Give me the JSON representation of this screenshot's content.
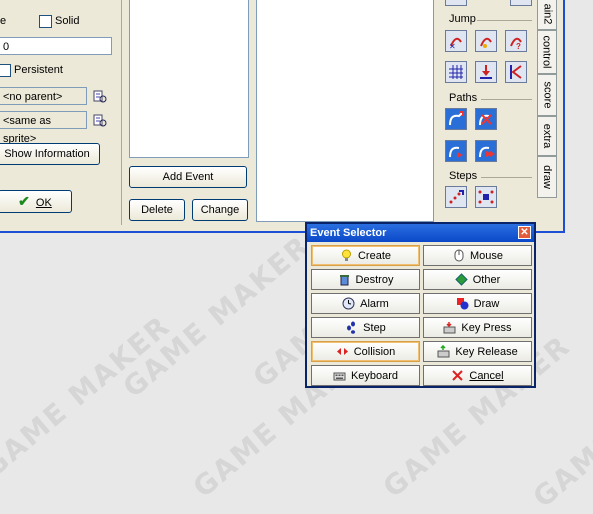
{
  "left_panel": {
    "partial_label": "e",
    "solid_label": "Solid",
    "depth_value": "0",
    "persistent_label": "Persistent",
    "parent_value": "<no parent>",
    "mask_value": "<same as sprite>",
    "show_info_label": "Show Information",
    "ok_label": "OK"
  },
  "events_panel": {
    "add_event_label": "Add Event",
    "delete_label": "Delete",
    "change_label": "Change"
  },
  "palette": {
    "groups": [
      "Jump",
      "Paths",
      "Steps"
    ]
  },
  "tabs": [
    "ain2",
    "control",
    "score",
    "extra",
    "draw"
  ],
  "event_selector": {
    "title": "Event Selector",
    "close_glyph": "✕",
    "buttons": [
      {
        "label": "Create",
        "icon": "lightbulb-icon"
      },
      {
        "label": "Mouse",
        "icon": "mouse-icon"
      },
      {
        "label": "Destroy",
        "icon": "trash-icon"
      },
      {
        "label": "Other",
        "icon": "other-icon"
      },
      {
        "label": "Alarm",
        "icon": "alarm-clock-icon"
      },
      {
        "label": "Draw",
        "icon": "draw-icon"
      },
      {
        "label": "Step",
        "icon": "steps-icon"
      },
      {
        "label": "Key Press",
        "icon": "key-press-icon"
      },
      {
        "label": "Collision",
        "icon": "collision-icon"
      },
      {
        "label": "Key Release",
        "icon": "key-release-icon"
      },
      {
        "label": "Keyboard",
        "icon": "keyboard-icon"
      },
      {
        "label": "Cancel",
        "icon": "cancel-x-icon"
      }
    ]
  },
  "watermark": "GAME MAKER"
}
